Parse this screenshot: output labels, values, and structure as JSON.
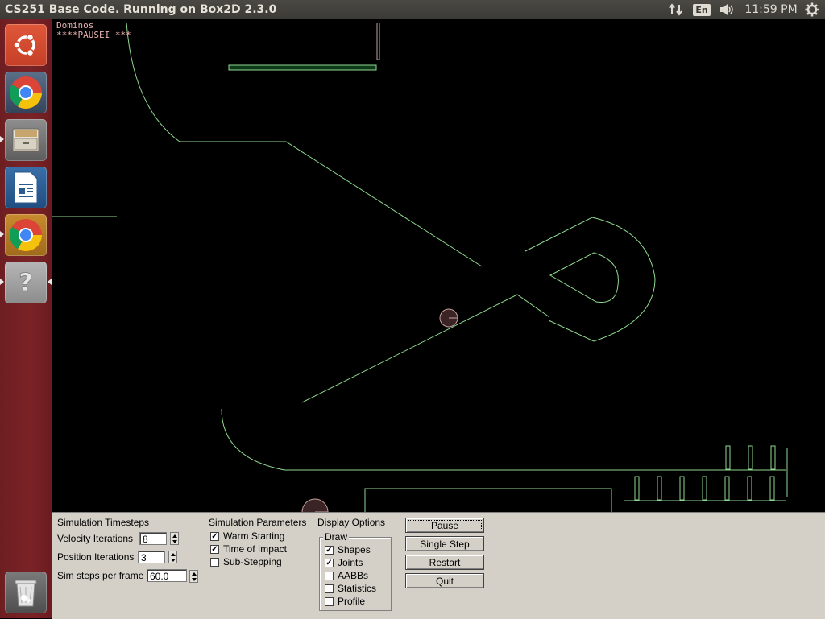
{
  "topbar": {
    "window_title": "CS251 Base Code. Running on Box2D 2.3.0",
    "keyboard_layout": "En",
    "clock": "11:59 PM"
  },
  "launcher": {
    "items": [
      {
        "name": "Dash Home",
        "icon": "ubuntu-logo-icon"
      },
      {
        "name": "Chromium",
        "icon": "chrome-icon"
      },
      {
        "name": "Files",
        "icon": "file-cabinet-icon"
      },
      {
        "name": "LibreOffice Writer",
        "icon": "document-icon"
      },
      {
        "name": "Chrome",
        "icon": "chrome-icon"
      },
      {
        "name": "Unknown Application",
        "icon": "question-mark-icon"
      },
      {
        "name": "Trash",
        "icon": "trash-icon"
      }
    ]
  },
  "canvas": {
    "title": "Dominos",
    "status": "****PAUSEI ***",
    "colors": {
      "shape": "#8fd98f",
      "platform_fill": "#0f3a1a",
      "ball": "#c9a0a0"
    }
  },
  "panel": {
    "timesteps": {
      "title": "Simulation Timesteps",
      "velocity_label": "Velocity Iterations",
      "velocity_value": "8",
      "position_label": "Position Iterations",
      "position_value": "3",
      "hz_label": "Sim steps per frame",
      "hz_value": "60.0"
    },
    "parameters": {
      "title": "Simulation Parameters",
      "warm_starting": {
        "label": "Warm Starting",
        "checked": true
      },
      "time_of_impact": {
        "label": "Time of Impact",
        "checked": true
      },
      "sub_stepping": {
        "label": "Sub-Stepping",
        "checked": false
      }
    },
    "display": {
      "title": "Display Options",
      "group": "Draw",
      "shapes": {
        "label": "Shapes",
        "checked": true
      },
      "joints": {
        "label": "Joints",
        "checked": true
      },
      "aabbs": {
        "label": "AABBs",
        "checked": false
      },
      "statistics": {
        "label": "Statistics",
        "checked": false
      },
      "profile": {
        "label": "Profile",
        "checked": false
      }
    },
    "buttons": {
      "pause": "Pause",
      "single_step": "Single Step",
      "restart": "Restart",
      "quit": "Quit"
    }
  }
}
